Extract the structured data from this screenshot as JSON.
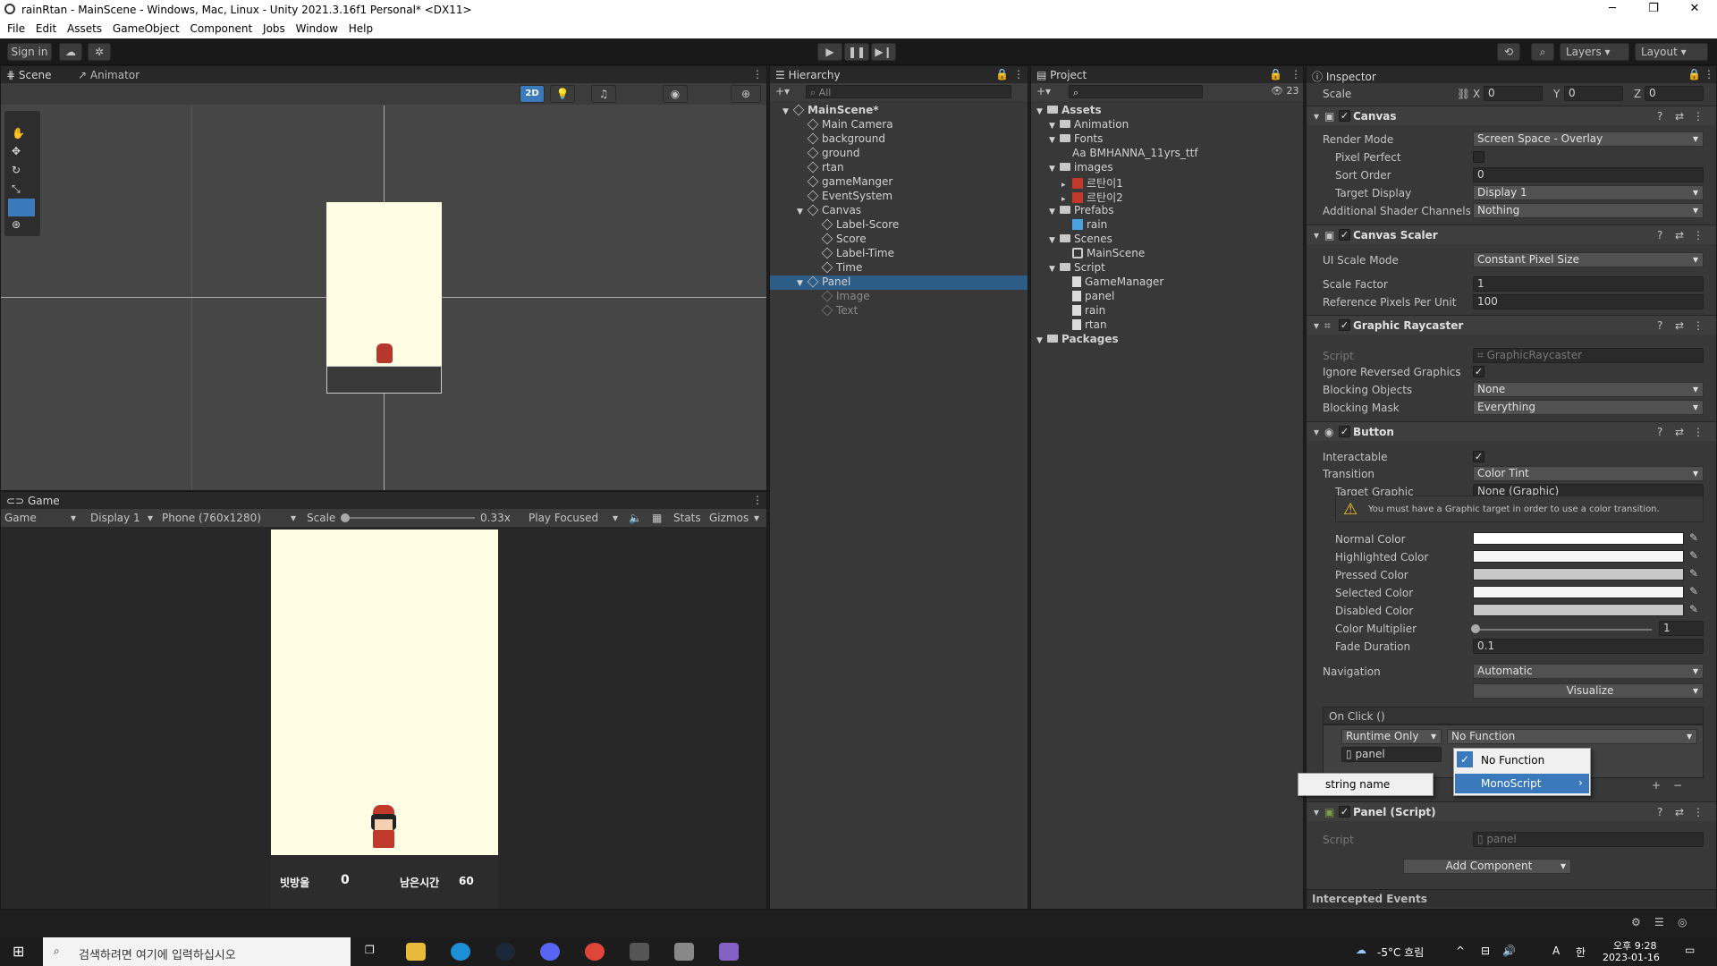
{
  "window": {
    "title": "rainRtan - MainScene - Windows, Mac, Linux - Unity 2021.3.16f1 Personal* <DX11>",
    "minimize": "─",
    "maximize": "❐",
    "close": "✕"
  },
  "menu": [
    "File",
    "Edit",
    "Assets",
    "GameObject",
    "Component",
    "Jobs",
    "Window",
    "Help"
  ],
  "toolbar": {
    "signin": "Sign in",
    "layers": "Layers",
    "layout": "Layout"
  },
  "scene": {
    "tabs": [
      "Scene",
      "Animator"
    ],
    "mode2d": "2D"
  },
  "game": {
    "tab": "Game",
    "view_mode": "Game",
    "display": "Display 1",
    "resolution": "Phone (760x1280)",
    "scale_label": "Scale",
    "scale_value": "0.33x",
    "play_mode": "Play Focused",
    "stats": "Stats",
    "gizmos": "Gizmos",
    "hud": {
      "score_label": "빗방울",
      "score": "0",
      "time_label": "남은시간",
      "time": "60"
    }
  },
  "hierarchy": {
    "tab": "Hierarchy",
    "search": "All",
    "items": [
      {
        "label": "MainScene*",
        "level": 0,
        "bold": true
      },
      {
        "label": "Main Camera",
        "level": 1
      },
      {
        "label": "background",
        "level": 1
      },
      {
        "label": "ground",
        "level": 1
      },
      {
        "label": "rtan",
        "level": 1
      },
      {
        "label": "gameManger",
        "level": 1
      },
      {
        "label": "EventSystem",
        "level": 1
      },
      {
        "label": "Canvas",
        "level": 1,
        "open": true
      },
      {
        "label": "Label-Score",
        "level": 2
      },
      {
        "label": "Score",
        "level": 2
      },
      {
        "label": "Label-Time",
        "level": 2
      },
      {
        "label": "Time",
        "level": 2
      },
      {
        "label": "Panel",
        "level": 1,
        "selected": true,
        "open": true
      },
      {
        "label": "Image",
        "level": 2,
        "dim": true
      },
      {
        "label": "Text",
        "level": 2,
        "dim": true
      }
    ]
  },
  "project": {
    "tab": "Project",
    "hidden_count": "23",
    "items": [
      {
        "label": "Assets",
        "level": 0,
        "type": "folder",
        "bold": true
      },
      {
        "label": "Animation",
        "level": 1,
        "type": "folder"
      },
      {
        "label": "Fonts",
        "level": 1,
        "type": "folder"
      },
      {
        "label": "Aa BMHANNA_11yrs_ttf",
        "level": 2,
        "type": "font"
      },
      {
        "label": "images",
        "level": 1,
        "type": "folder"
      },
      {
        "label": "르탄이1",
        "level": 2,
        "type": "sprite"
      },
      {
        "label": "르탄이2",
        "level": 2,
        "type": "sprite"
      },
      {
        "label": "Prefabs",
        "level": 1,
        "type": "folder"
      },
      {
        "label": "rain",
        "level": 2,
        "type": "prefab"
      },
      {
        "label": "Scenes",
        "level": 1,
        "type": "folder"
      },
      {
        "label": "MainScene",
        "level": 2,
        "type": "scene"
      },
      {
        "label": "Script",
        "level": 1,
        "type": "folder"
      },
      {
        "label": "GameManager",
        "level": 2,
        "type": "script"
      },
      {
        "label": "panel",
        "level": 2,
        "type": "script"
      },
      {
        "label": "rain",
        "level": 2,
        "type": "script"
      },
      {
        "label": "rtan",
        "level": 2,
        "type": "script"
      },
      {
        "label": "Packages",
        "level": 0,
        "type": "folder",
        "bold": true
      }
    ]
  },
  "inspector": {
    "tab": "Inspector",
    "scale_label": "Scale",
    "scale": {
      "x": "0",
      "y": "0",
      "z": "0"
    },
    "canvas": {
      "title": "Canvas",
      "render_mode_label": "Render Mode",
      "render_mode": "Screen Space - Overlay",
      "pixel_perfect_label": "Pixel Perfect",
      "sort_order_label": "Sort Order",
      "sort_order": "0",
      "target_display_label": "Target Display",
      "target_display": "Display 1",
      "shader_channels_label": "Additional Shader Channels",
      "shader_channels": "Nothing"
    },
    "scaler": {
      "title": "Canvas Scaler",
      "mode_label": "UI Scale Mode",
      "mode": "Constant Pixel Size",
      "factor_label": "Scale Factor",
      "factor": "1",
      "ref_label": "Reference Pixels Per Unit",
      "ref": "100"
    },
    "raycaster": {
      "title": "Graphic Raycaster",
      "script_label": "Script",
      "script": "GraphicRaycaster",
      "ignore_label": "Ignore Reversed Graphics",
      "blocking_label": "Blocking Objects",
      "blocking": "None",
      "mask_label": "Blocking Mask",
      "mask": "Everything"
    },
    "button": {
      "title": "Button",
      "interactable_label": "Interactable",
      "transition_label": "Transition",
      "transition": "Color Tint",
      "target_label": "Target Graphic",
      "target": "None (Graphic)",
      "warning": "You must have a Graphic target in order to use a color transition.",
      "normal": "Normal Color",
      "highlighted": "Highlighted Color",
      "pressed": "Pressed Color",
      "selected": "Selected Color",
      "disabled": "Disabled Color",
      "multiplier_label": "Color Multiplier",
      "multiplier": "1",
      "fade_label": "Fade Duration",
      "fade": "0.1",
      "nav_label": "Navigation",
      "nav": "Automatic",
      "visualize": "Visualize",
      "onclick": "On Click ()",
      "runtime": "Runtime Only",
      "function": "No Function",
      "object": "panel",
      "plus": "+",
      "minus": "−"
    },
    "popup": {
      "no_function": "No Function",
      "monoscript": "MonoScript",
      "string_name": "string name"
    },
    "panel_script": {
      "title": "Panel (Script)",
      "script_label": "Script",
      "script": "panel"
    },
    "add_component": "Add Component",
    "intercepted": "Intercepted Events"
  },
  "taskbar": {
    "search_placeholder": "검색하려면 여기에 입력하십시오",
    "weather": "-5°C 흐림",
    "ime": "A",
    "time": "오후 9:28",
    "date": "2023-01-16"
  }
}
